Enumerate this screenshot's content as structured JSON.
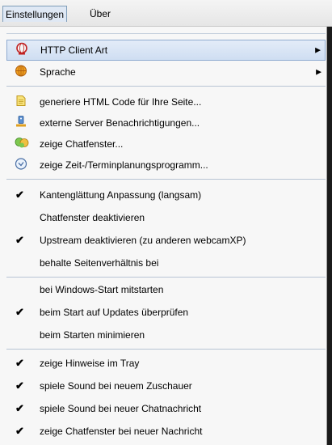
{
  "menubar": {
    "settings": "Einstellungen",
    "about": "Über"
  },
  "menu": {
    "http_client": "HTTP Client Art",
    "language": "Sprache",
    "generate_html": "generiere HTML Code für Ihre Seite...",
    "server_notify": "externe Server Benachrichtigungen...",
    "show_chat": "zeige Chatfenster...",
    "show_scheduler": "zeige Zeit-/Terminplanungsprogramm...",
    "smoothing": "Kantenglättung Anpassung (langsam)",
    "disable_chat": "Chatfenster deaktivieren",
    "disable_upstream": "Upstream deaktivieren (zu anderen webcamXP)",
    "keep_ratio": "behalte Seitenverhältnis bei",
    "autostart": "bei Windows-Start mitstarten",
    "check_updates": "beim Start auf Updates überprüfen",
    "start_minimized": "beim Starten minimieren",
    "tray_hints": "zeige Hinweise im Tray",
    "sound_viewer": "spiele Sound bei neuem Zuschauer",
    "sound_chat": "spiele Sound bei neuer Chatnachricht",
    "show_chat_on_msg": "zeige Chatfenster bei neuer Nachricht"
  },
  "checked": {
    "smoothing": true,
    "disable_chat": false,
    "disable_upstream": true,
    "keep_ratio": false,
    "autostart": false,
    "check_updates": true,
    "start_minimized": false,
    "tray_hints": true,
    "sound_viewer": true,
    "sound_chat": true,
    "show_chat_on_msg": true
  },
  "icons": {
    "http_client": "globe-icon",
    "language": "globe-language-icon",
    "generate_html": "document-icon",
    "server_notify": "server-icon",
    "show_chat": "chat-icon",
    "show_scheduler": "clock-icon",
    "check": "checkmark-icon",
    "submenu_arrow": "submenu-arrow-icon"
  }
}
